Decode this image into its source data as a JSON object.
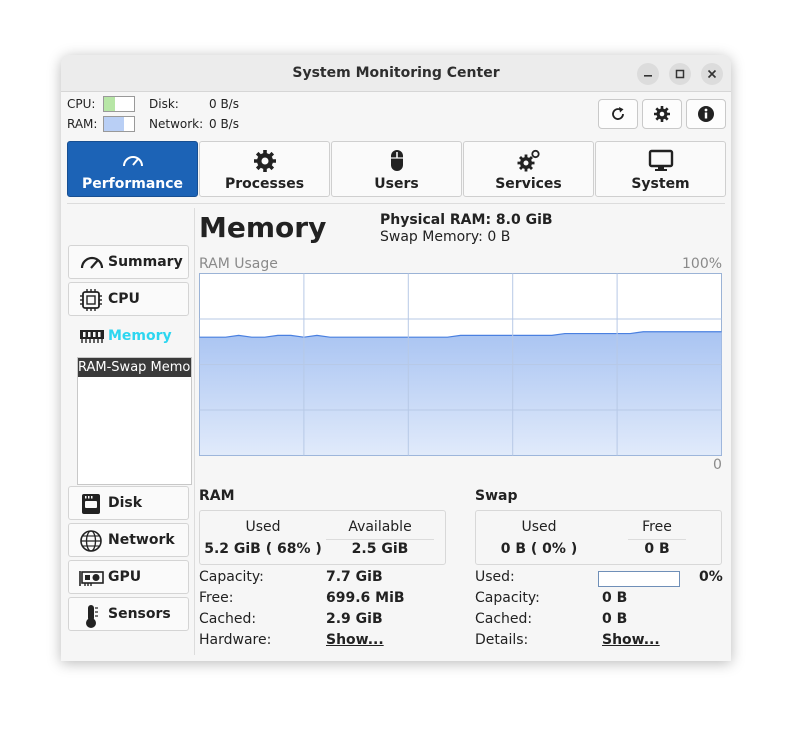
{
  "window": {
    "title": "System Monitoring Center"
  },
  "mini": {
    "cpu_label": "CPU:",
    "ram_label": "RAM:",
    "disk_label": "Disk:",
    "disk_value": "0 B/s",
    "network_label": "Network:",
    "network_value": "0 B/s",
    "cpu_color": "#b7e6a6",
    "ram_color": "#b9cff5"
  },
  "tabs": [
    {
      "label": "Performance",
      "icon": "gauge-icon"
    },
    {
      "label": "Processes",
      "icon": "gear-icon"
    },
    {
      "label": "Users",
      "icon": "mouse-icon"
    },
    {
      "label": "Services",
      "icon": "gears-icon"
    },
    {
      "label": "System",
      "icon": "monitor-icon"
    }
  ],
  "sidebar": {
    "items": [
      "Summary",
      "CPU",
      "Memory",
      "Disk",
      "Network",
      "GPU",
      "Sensors"
    ],
    "sublist_item": "RAM-Swap Memory"
  },
  "memory": {
    "heading": "Memory",
    "physical_ram": "Physical RAM: 8.0 GiB",
    "swap_memory": "Swap Memory: 0 B",
    "chart_label": "RAM Usage",
    "chart_max": "100%",
    "chart_min": "0"
  },
  "chart_data": {
    "type": "area",
    "title": "RAM Usage",
    "ylim": [
      0,
      100
    ],
    "y_unit": "%",
    "grid": true,
    "fill_color": "#a9c4f2",
    "line_color": "#4a80e0",
    "values": [
      65,
      65,
      65,
      66,
      65,
      65,
      66,
      66,
      65,
      66,
      65,
      65,
      65,
      65,
      65,
      65,
      65,
      65,
      65,
      65,
      66,
      66,
      66,
      66,
      66,
      66,
      66,
      66,
      67,
      67,
      67,
      67,
      67,
      67,
      68,
      68,
      68,
      68,
      68,
      68,
      68
    ]
  },
  "ram": {
    "heading": "RAM",
    "used_label": "Used",
    "used_value": "5.2 GiB  ( 68% )",
    "available_label": "Available",
    "available_value": "2.5 GiB",
    "capacity_label": "Capacity:",
    "capacity_value": "7.7 GiB",
    "free_label": "Free:",
    "free_value": "699.6 MiB",
    "cached_label": "Cached:",
    "cached_value": "2.9 GiB",
    "hardware_label": "Hardware:",
    "hardware_link": "Show..."
  },
  "swap": {
    "heading": "Swap",
    "used_label": "Used",
    "used_value": "0 B  ( 0% )",
    "free_label": "Free",
    "free_value": "0 B",
    "used_bar_label": "Used:",
    "used_percent": "0%",
    "used_fraction": 0,
    "capacity_label": "Capacity:",
    "capacity_value": "0 B",
    "cached_label": "Cached:",
    "cached_value": "0 B",
    "details_label": "Details:",
    "details_link": "Show..."
  }
}
